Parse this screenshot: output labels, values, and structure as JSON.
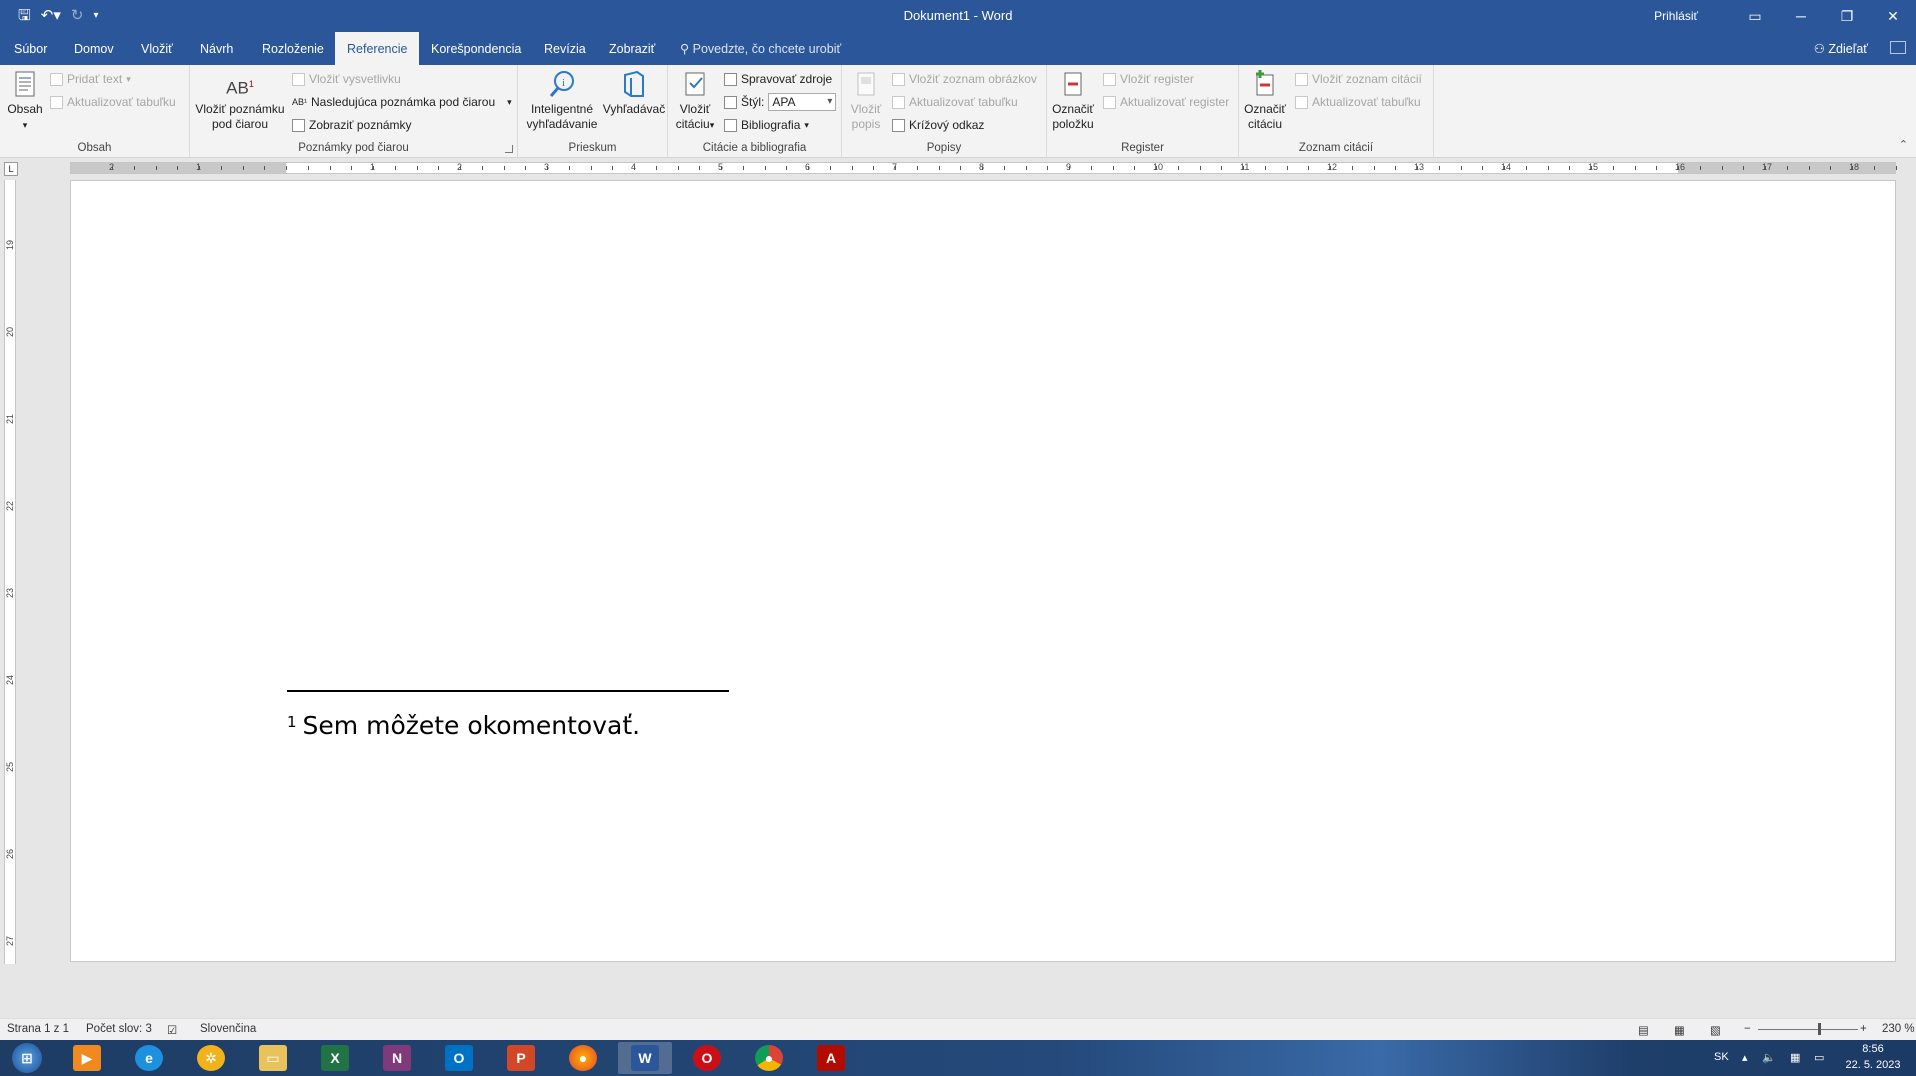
{
  "titlebar": {
    "title": "Dokument1  -  Word",
    "signin": "Prihlásiť"
  },
  "tabs": [
    "Súbor",
    "Domov",
    "Vložiť",
    "Návrh",
    "Rozloženie",
    "Referencie",
    "Korešpondencia",
    "Revízia",
    "Zobraziť"
  ],
  "active_tab": "Referencie",
  "tellme": "Povedzte, čo chcete urobiť",
  "share": "Zdieľať",
  "ribbon": {
    "obsah": {
      "group_label": "Obsah",
      "obsah_btn": "Obsah",
      "pridat_text": "Pridať text",
      "aktualizovat_tabulku": "Aktualizovať tabuľku"
    },
    "poznamky": {
      "group_label": "Poznámky pod čiarou",
      "vlozit_poznamku_1": "Vložiť poznámku",
      "vlozit_poznamku_2": "pod čiarou",
      "vlozit_vysvetlivku": "Vložiť vysvetlivku",
      "nasledujuca": "Nasledujúca poznámka pod čiarou",
      "zobrazit": "Zobraziť poznámky"
    },
    "prieskum": {
      "group_label": "Prieskum",
      "inteligentne_1": "Inteligentné",
      "inteligentne_2": "vyhľadávanie",
      "vyhladavac": "Vyhľadávač"
    },
    "citacie": {
      "group_label": "Citácie a bibliografia",
      "vlozit_1": "Vložiť",
      "vlozit_2": "citáciu",
      "spravovat": "Spravovať zdroje",
      "styl_label": "Štýl:",
      "styl_value": "APA",
      "bibliografia": "Bibliografia"
    },
    "popisy": {
      "group_label": "Popisy",
      "vlozit_popis_1": "Vložiť",
      "vlozit_popis_2": "popis",
      "zoznam_obrazkov": "Vložiť zoznam obrázkov",
      "aktualizovat": "Aktualizovať tabuľku",
      "krizovy": "Krížový odkaz"
    },
    "register": {
      "group_label": "Register",
      "oznacit_1": "Označiť",
      "oznacit_2": "položku",
      "vlozit_register": "Vložiť register",
      "aktualizovat": "Aktualizovať register"
    },
    "zoznam_citacii": {
      "group_label": "Zoznam citácií",
      "oznacit_1": "Označiť",
      "oznacit_2": "citáciu",
      "vlozit": "Vložiť zoznam citácií",
      "aktualizovat": "Aktualizovať tabuľku"
    }
  },
  "ruler": {
    "h_numbers": [
      "2",
      "1",
      "1",
      "2",
      "3",
      "4",
      "5",
      "6",
      "7",
      "8",
      "9",
      "10",
      "11",
      "12",
      "13",
      "14",
      "15",
      "16",
      "17",
      "18"
    ],
    "v_numbers": [
      "19",
      "20",
      "21",
      "22",
      "23",
      "24",
      "25",
      "26",
      "27"
    ]
  },
  "document": {
    "footnote_number": "1",
    "footnote_text": "Sem môžete okomentovať."
  },
  "statusbar": {
    "page": "Strana 1 z 1",
    "words": "Počet slov: 3",
    "language": "Slovenčina",
    "zoom": "230 %"
  },
  "taskbar": {
    "lang": "SK",
    "time": "8:56",
    "date": "22. 5. 2023"
  },
  "colors": {
    "word_blue": "#2b579a",
    "ribbon_bg": "#f3f3f3"
  }
}
